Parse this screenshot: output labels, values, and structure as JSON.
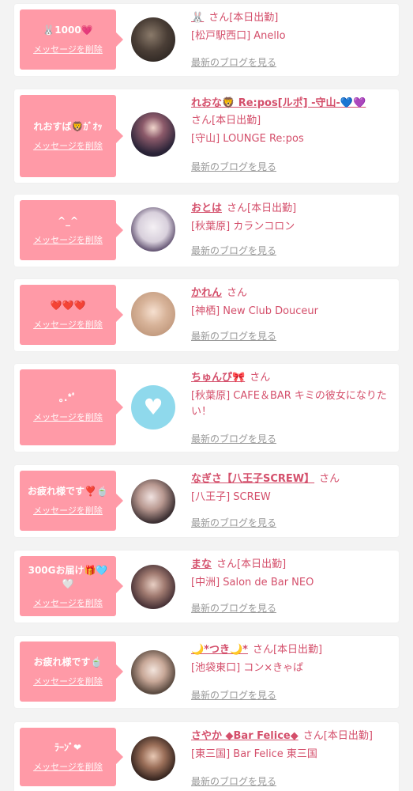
{
  "cards": [
    {
      "message": "🐰1000💗",
      "delete_label": "メッセージを削除",
      "name": "🐰",
      "san": "さん[本日出勤]",
      "store": "[松戸駅西口] Anello",
      "blog_label": "最新のブログを見る"
    },
    {
      "message": "れおすば🦁ｶﾞｵｯ",
      "delete_label": "メッセージを削除",
      "name": "れおな🦁 Re:pos[ルポ] -守山-💙💜",
      "san": "さん[本日出勤]",
      "store": "[守山] LOUNGE Re:pos",
      "blog_label": "最新のブログを見る"
    },
    {
      "message": "^_^",
      "delete_label": "メッセージを削除",
      "name": "おとは",
      "san": "さん[本日出勤]",
      "store": "[秋葉原] カランコロン",
      "blog_label": "最新のブログを見る"
    },
    {
      "message": "❤️❤️❤️",
      "delete_label": "メッセージを削除",
      "name": "かれん",
      "san": "さん",
      "store": "[神栖] New Club Douceur",
      "blog_label": "最新のブログを見る"
    },
    {
      "message": "｡.*ﾟ",
      "delete_label": "メッセージを削除",
      "name": "ちゅんぴ🎀",
      "san": "さん",
      "store": "[秋葉原] CAFE＆BAR キミの彼女になりたい！",
      "blog_label": "最新のブログを見る"
    },
    {
      "message": "お疲れ様です❣️🍵",
      "delete_label": "メッセージを削除",
      "name": "なぎさ【八王子SCREW】",
      "san": "さん",
      "store": "[八王子] SCREW",
      "blog_label": "最新のブログを見る"
    },
    {
      "message": "300Gお届け🎁🩵🤍",
      "delete_label": "メッセージを削除",
      "name": "まな",
      "san": "さん[本日出勤]",
      "store": "[中洲] Salon de Bar NEO",
      "blog_label": "最新のブログを見る"
    },
    {
      "message": "お疲れ様です🍵",
      "delete_label": "メッセージを削除",
      "name": "🌙*つき🌙*",
      "san": "さん[本日出勤]",
      "store": "[池袋東口] コン×きゃば",
      "blog_label": "最新のブログを見る"
    },
    {
      "message": "ﾗｰﾝﾞ❤︎",
      "delete_label": "メッセージを削除",
      "name": "さやか ◆Bar Felice◆",
      "san": "さん[本日出勤]",
      "store": "[東三国] Bar Felice 東三国",
      "blog_label": "最新のブログを見る"
    }
  ],
  "colors": {
    "accent": "#d44f6b",
    "bubble": "#ff9aa7",
    "link_gray": "#999999",
    "background": "#f3f3f3"
  }
}
